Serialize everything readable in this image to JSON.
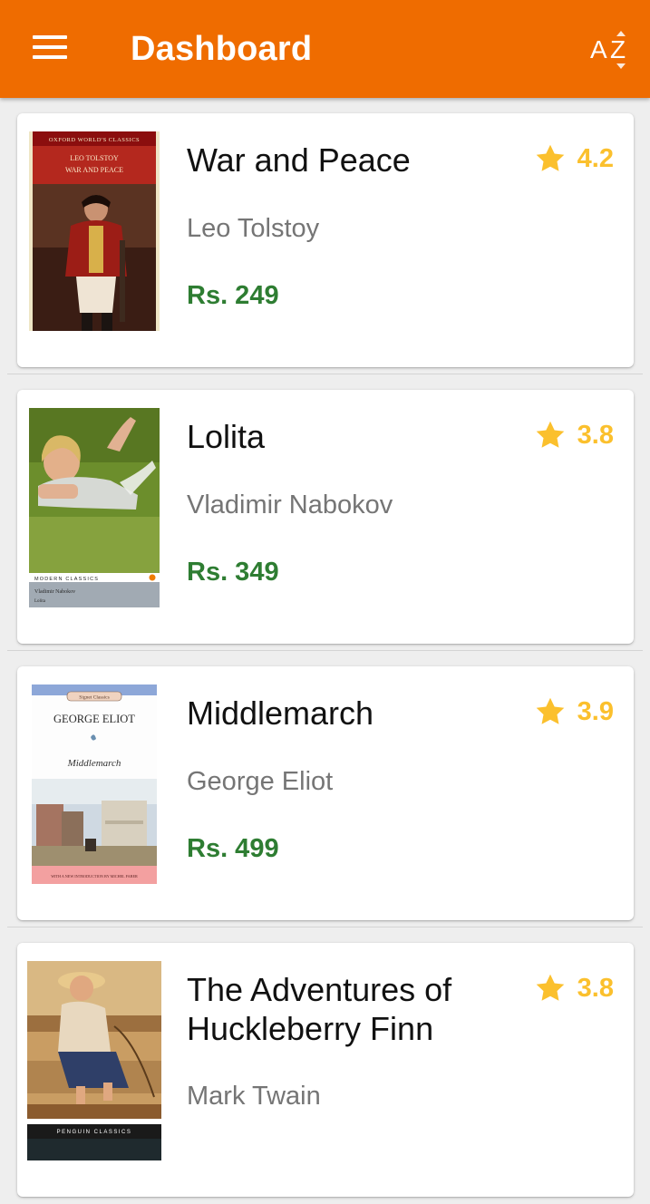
{
  "colors": {
    "appbar": "#ef6c00",
    "price": "#2e7d32",
    "rating": "#fbc02d",
    "author": "#757575"
  },
  "appbar": {
    "title": "Dashboard",
    "menu_icon": "hamburger-menu-icon",
    "sort_icon": "sort-az-icon",
    "sort_glyph_a": "A",
    "sort_glyph_z": "Z"
  },
  "books": [
    {
      "title": "War and Peace",
      "author": "Leo Tolstoy",
      "price": "Rs. 249",
      "rating": "4.2",
      "cover": {
        "band_text": "OXFORD WORLD'S CLASSICS",
        "line1": "LEO TOLSTOY",
        "line2": "WAR AND PEACE"
      }
    },
    {
      "title": "Lolita",
      "author": "Vladimir Nabokov",
      "price": "Rs. 349",
      "rating": "3.8",
      "cover": {
        "band_text": "MODERN CLASSICS",
        "line1": "Vladimir Nabokov",
        "line2": "Lolita"
      }
    },
    {
      "title": "Middlemarch",
      "author": "George Eliot",
      "price": "Rs. 499",
      "rating": "3.9",
      "cover": {
        "badge": "Signet Classics",
        "line1": "GEORGE ELIOT",
        "line2": "Middlemarch",
        "footer": "WITH A NEW INTRODUCTION BY MICHEL FABER"
      }
    },
    {
      "title": "The Adventures of Huckleberry Finn",
      "author": "Mark Twain",
      "price": "",
      "rating": "3.8",
      "cover": {
        "band_text": "PENGUIN CLASSICS"
      }
    }
  ]
}
